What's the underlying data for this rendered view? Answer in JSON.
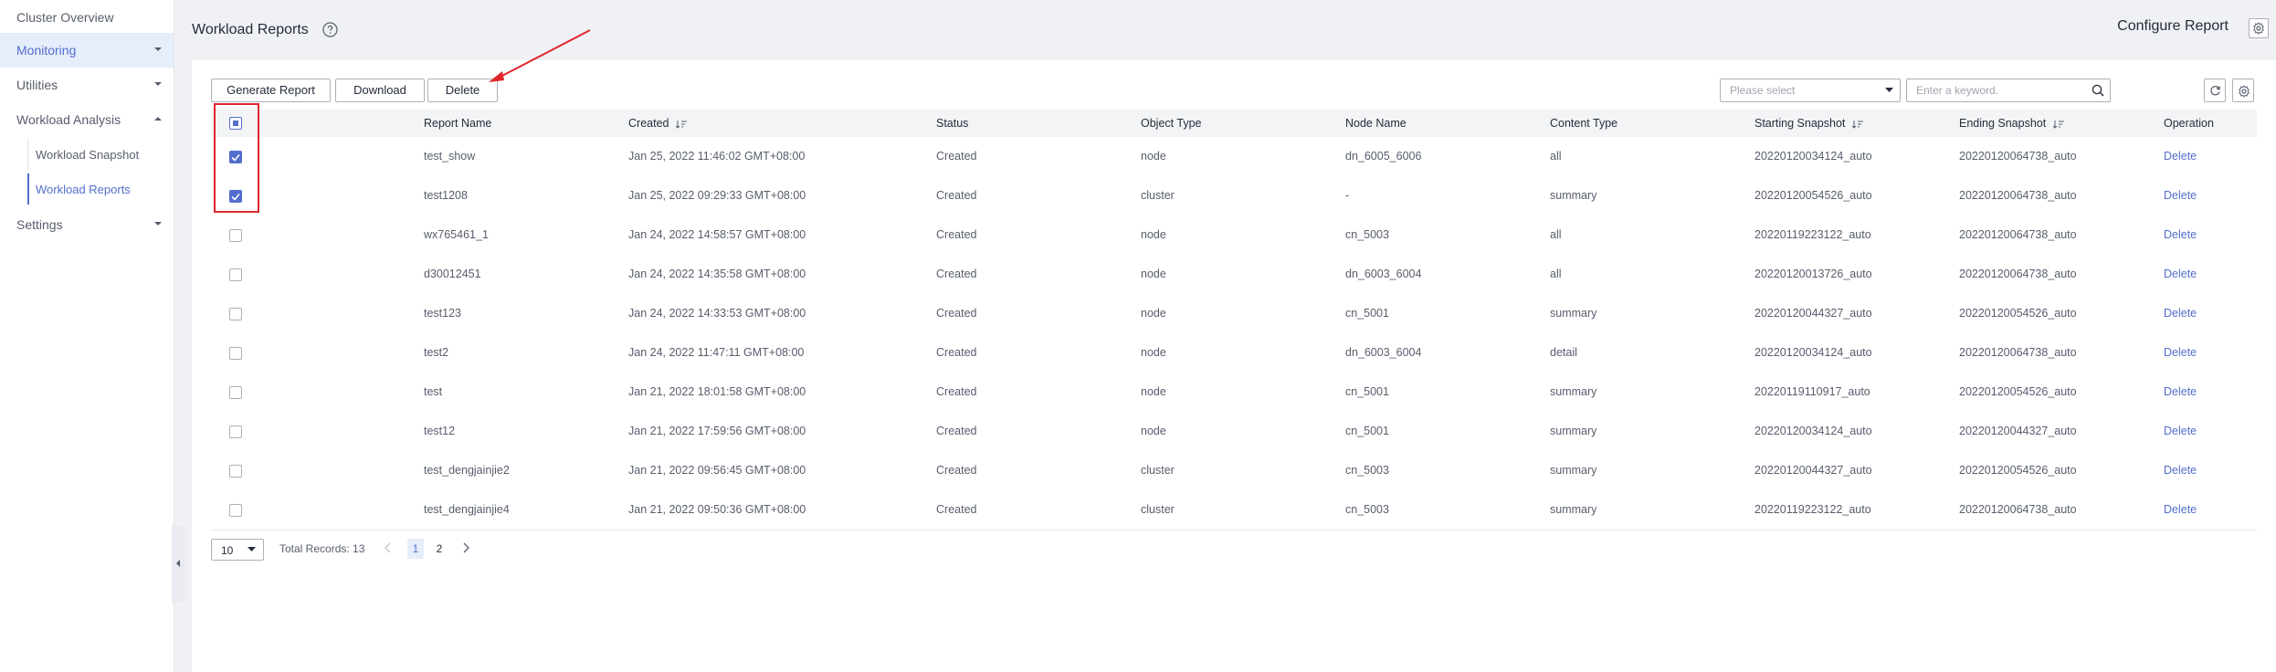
{
  "sidebar": {
    "items": [
      {
        "label": "Cluster Overview"
      },
      {
        "label": "Monitoring"
      },
      {
        "label": "Utilities"
      },
      {
        "label": "Workload Analysis"
      },
      {
        "label": "Settings"
      }
    ],
    "sub_items": [
      {
        "label": "Workload Snapshot"
      },
      {
        "label": "Workload Reports"
      }
    ]
  },
  "header": {
    "title": "Workload Reports",
    "configure_label": "Configure Report"
  },
  "toolbar": {
    "generate_label": "Generate Report",
    "download_label": "Download",
    "delete_label": "Delete",
    "select_placeholder": "Please select",
    "search_placeholder": "Enter a keyword."
  },
  "table": {
    "columns": {
      "report_name": "Report Name",
      "created": "Created",
      "status": "Status",
      "object_type": "Object Type",
      "node_name": "Node Name",
      "content_type": "Content Type",
      "starting_snapshot": "Starting Snapshot",
      "ending_snapshot": "Ending Snapshot",
      "operation": "Operation"
    },
    "rows": [
      {
        "checked": true,
        "report_name": "test_show",
        "created": "Jan 25, 2022 11:46:02 GMT+08:00",
        "status": "Created",
        "object_type": "node",
        "node_name": "dn_6005_6006",
        "content_type": "all",
        "starting_snapshot": "20220120034124_auto",
        "ending_snapshot": "20220120064738_auto",
        "operation": "Delete"
      },
      {
        "checked": true,
        "report_name": "test1208",
        "created": "Jan 25, 2022 09:29:33 GMT+08:00",
        "status": "Created",
        "object_type": "cluster",
        "node_name": "-",
        "content_type": "summary",
        "starting_snapshot": "20220120054526_auto",
        "ending_snapshot": "20220120064738_auto",
        "operation": "Delete"
      },
      {
        "checked": false,
        "report_name": "wx765461_1",
        "created": "Jan 24, 2022 14:58:57 GMT+08:00",
        "status": "Created",
        "object_type": "node",
        "node_name": "cn_5003",
        "content_type": "all",
        "starting_snapshot": "20220119223122_auto",
        "ending_snapshot": "20220120064738_auto",
        "operation": "Delete"
      },
      {
        "checked": false,
        "report_name": "d30012451",
        "created": "Jan 24, 2022 14:35:58 GMT+08:00",
        "status": "Created",
        "object_type": "node",
        "node_name": "dn_6003_6004",
        "content_type": "all",
        "starting_snapshot": "20220120013726_auto",
        "ending_snapshot": "20220120064738_auto",
        "operation": "Delete"
      },
      {
        "checked": false,
        "report_name": "test123",
        "created": "Jan 24, 2022 14:33:53 GMT+08:00",
        "status": "Created",
        "object_type": "node",
        "node_name": "cn_5001",
        "content_type": "summary",
        "starting_snapshot": "20220120044327_auto",
        "ending_snapshot": "20220120054526_auto",
        "operation": "Delete"
      },
      {
        "checked": false,
        "report_name": "test2",
        "created": "Jan 24, 2022 11:47:11 GMT+08:00",
        "status": "Created",
        "object_type": "node",
        "node_name": "dn_6003_6004",
        "content_type": "detail",
        "starting_snapshot": "20220120034124_auto",
        "ending_snapshot": "20220120064738_auto",
        "operation": "Delete"
      },
      {
        "checked": false,
        "report_name": "test",
        "created": "Jan 21, 2022 18:01:58 GMT+08:00",
        "status": "Created",
        "object_type": "node",
        "node_name": "cn_5001",
        "content_type": "summary",
        "starting_snapshot": "20220119110917_auto",
        "ending_snapshot": "20220120054526_auto",
        "operation": "Delete"
      },
      {
        "checked": false,
        "report_name": "test12",
        "created": "Jan 21, 2022 17:59:56 GMT+08:00",
        "status": "Created",
        "object_type": "node",
        "node_name": "cn_5001",
        "content_type": "summary",
        "starting_snapshot": "20220120034124_auto",
        "ending_snapshot": "20220120044327_auto",
        "operation": "Delete"
      },
      {
        "checked": false,
        "report_name": "test_dengjainjie2",
        "created": "Jan 21, 2022 09:56:45 GMT+08:00",
        "status": "Created",
        "object_type": "cluster",
        "node_name": "cn_5003",
        "content_type": "summary",
        "starting_snapshot": "20220120044327_auto",
        "ending_snapshot": "20220120054526_auto",
        "operation": "Delete"
      },
      {
        "checked": false,
        "report_name": "test_dengjainjie4",
        "created": "Jan 21, 2022 09:50:36 GMT+08:00",
        "status": "Created",
        "object_type": "cluster",
        "node_name": "cn_5003",
        "content_type": "summary",
        "starting_snapshot": "20220119223122_auto",
        "ending_snapshot": "20220120064738_auto",
        "operation": "Delete"
      }
    ]
  },
  "pagination": {
    "page_size": "10",
    "total_text": "Total Records: 13",
    "pages": [
      "1",
      "2"
    ],
    "current_page": "1"
  },
  "colors": {
    "accent": "#526ecc",
    "highlight": "#e0262c"
  }
}
